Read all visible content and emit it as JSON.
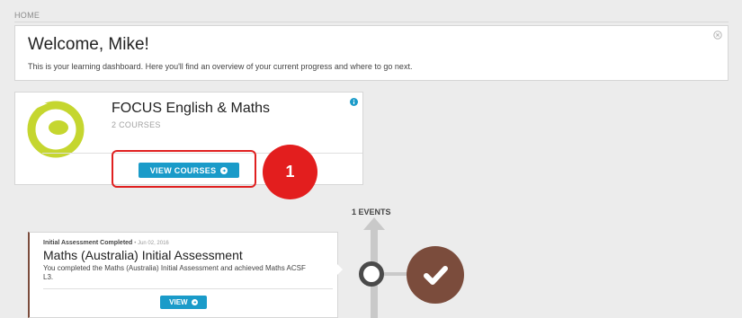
{
  "breadcrumb": {
    "home": "HOME"
  },
  "welcome": {
    "title": "Welcome, Mike!",
    "subtitle": "This is your learning dashboard. Here you'll find an overview of your current progress and where to go next."
  },
  "program": {
    "title": "FOCUS English & Maths",
    "course_count": "2 COURSES",
    "view_courses_label": "VIEW COURSES",
    "logo_colors": {
      "ring": "#c5d62f",
      "center": "#c5d62f"
    }
  },
  "annotation": {
    "step_number": "1",
    "color": "#e31e1e"
  },
  "timeline": {
    "events_label": "1 EVENTS",
    "event": {
      "type": "Initial Assessment Completed",
      "date": "Jun 02, 2016",
      "title": "Maths (Australia) Initial Assessment",
      "description": "You completed the Maths (Australia) Initial Assessment and achieved Maths ACSF L3.",
      "view_label": "VIEW"
    },
    "status_icon": "check-icon",
    "status_color": "#7b4c3c"
  },
  "accent": "#1a9bc9"
}
